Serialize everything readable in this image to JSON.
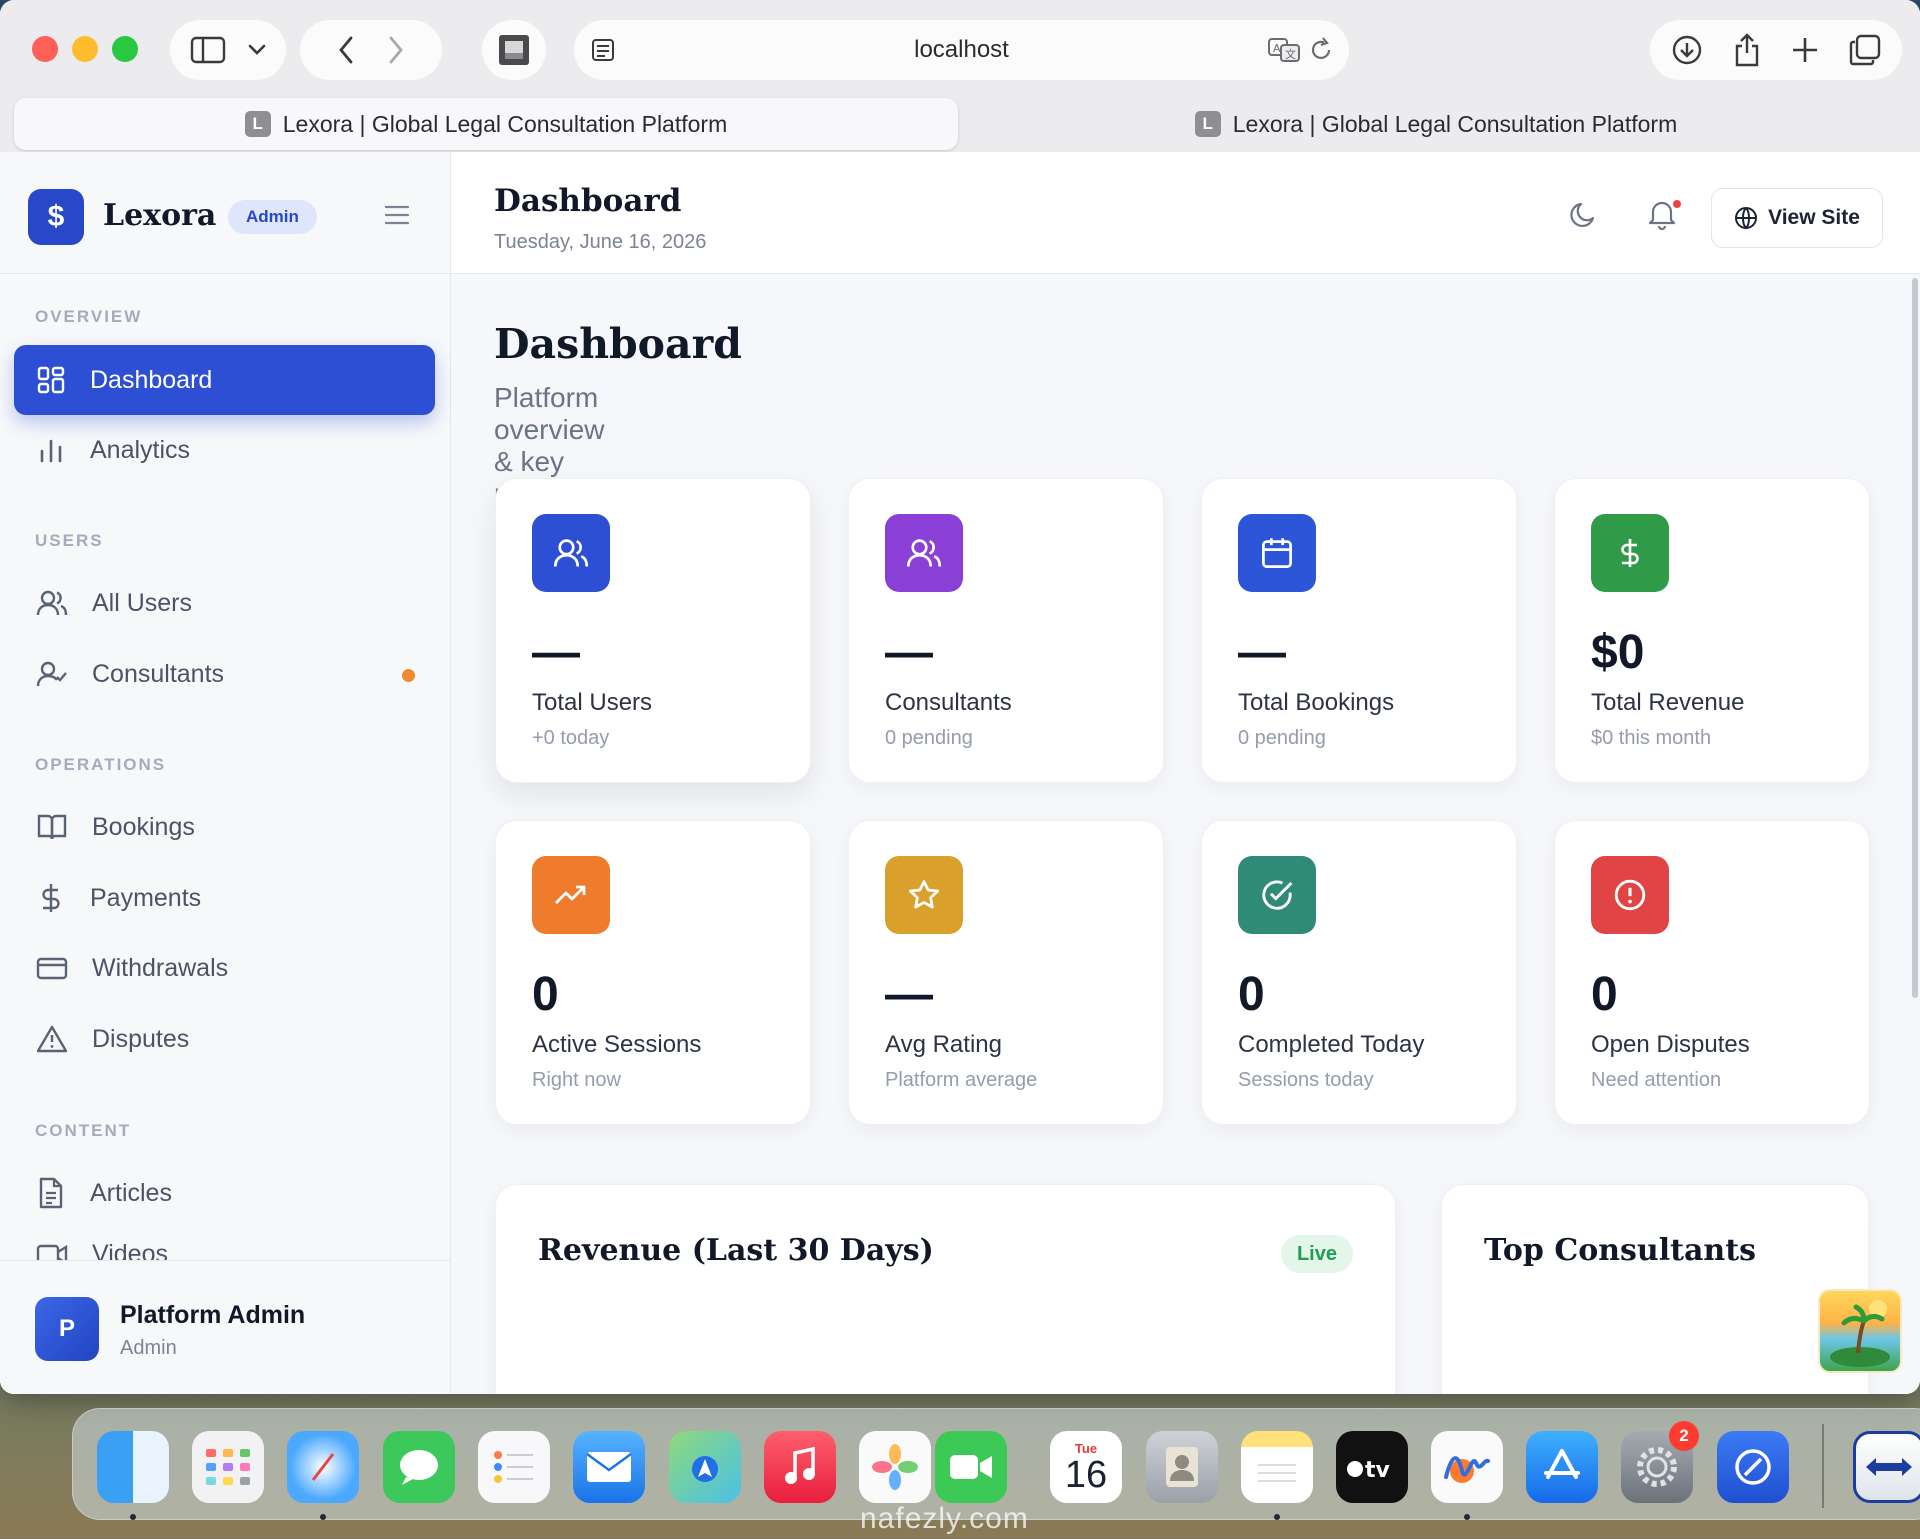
{
  "browser": {
    "url": "localhost",
    "tabs": [
      {
        "favicon_letter": "L",
        "title": "Lexora | Global Legal Consultation Platform",
        "active": true
      },
      {
        "favicon_letter": "L",
        "title": "Lexora | Global Legal Consultation Platform",
        "active": false
      }
    ]
  },
  "sidebar": {
    "brand_name": "Lexora",
    "brand_logo_symbol": "$",
    "brand_badge": "Admin",
    "sections": [
      {
        "title": "OVERVIEW",
        "items": [
          {
            "label": "Dashboard",
            "icon": "grid-icon",
            "active": true
          },
          {
            "label": "Analytics",
            "icon": "bar-chart-icon",
            "active": false
          }
        ]
      },
      {
        "title": "USERS",
        "items": [
          {
            "label": "All Users",
            "icon": "users-icon",
            "active": false
          },
          {
            "label": "Consultants",
            "icon": "user-check-icon",
            "active": false,
            "dot": true
          }
        ]
      },
      {
        "title": "OPERATIONS",
        "items": [
          {
            "label": "Bookings",
            "icon": "book-icon",
            "active": false
          },
          {
            "label": "Payments",
            "icon": "dollar-icon",
            "active": false
          },
          {
            "label": "Withdrawals",
            "icon": "credit-card-icon",
            "active": false
          },
          {
            "label": "Disputes",
            "icon": "warning-icon",
            "active": false
          }
        ]
      },
      {
        "title": "CONTENT",
        "items": [
          {
            "label": "Articles",
            "icon": "file-text-icon",
            "active": false
          },
          {
            "label": "Videos",
            "icon": "video-icon",
            "active": false
          }
        ]
      }
    ],
    "user": {
      "initial": "P",
      "name": "Platform Admin",
      "role": "Admin"
    }
  },
  "topbar": {
    "title": "Dashboard",
    "date": "Tuesday, June 16, 2026",
    "view_site_label": "View Site"
  },
  "page": {
    "title": "Dashboard",
    "subtitle": "Platform overview & key metrics"
  },
  "stats": [
    {
      "value": "—",
      "label": "Total Users",
      "sub": "+0 today",
      "icon": "users-icon",
      "color": "#2c4fd3"
    },
    {
      "value": "—",
      "label": "Consultants",
      "sub": "0 pending",
      "icon": "users-icon",
      "color": "#8a3fd6"
    },
    {
      "value": "—",
      "label": "Total Bookings",
      "sub": "0 pending",
      "icon": "calendar-icon",
      "color": "#2c55d8"
    },
    {
      "value": "$0",
      "label": "Total Revenue",
      "sub": "$0 this month",
      "icon": "dollar-icon",
      "color": "#2f9a48"
    },
    {
      "value": "0",
      "label": "Active Sessions",
      "sub": "Right now",
      "icon": "trending-up-icon",
      "color": "#ef7b2c"
    },
    {
      "value": "—",
      "label": "Avg Rating",
      "sub": "Platform average",
      "icon": "star-icon",
      "color": "#d9a02b"
    },
    {
      "value": "0",
      "label": "Completed Today",
      "sub": "Sessions today",
      "icon": "check-circle-icon",
      "color": "#2f8a77"
    },
    {
      "value": "0",
      "label": "Open Disputes",
      "sub": "Need attention",
      "icon": "alert-circle-icon",
      "color": "#e04444"
    }
  ],
  "panels": {
    "revenue_title": "Revenue (Last 30 Days)",
    "revenue_badge": "Live",
    "consultants_title": "Top Consultants"
  },
  "dock": {
    "calendar_day": "Tue",
    "calendar_date": "16",
    "settings_badge": "2",
    "watermark": "nafezly.com"
  }
}
